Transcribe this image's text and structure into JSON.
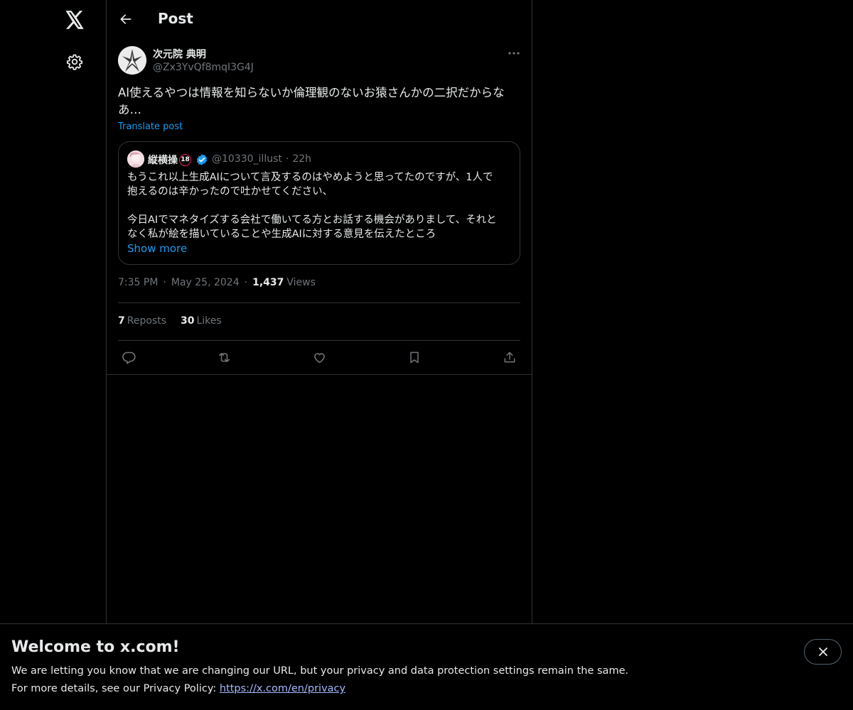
{
  "header": {
    "title": "Post"
  },
  "post": {
    "author_name": "次元院 典明",
    "author_handle": "@Zx3YvQf8mqI3G4J",
    "text": "AI使えるやつは情報を知らないか倫理観のないお猿さんかの二択だからなあ…",
    "translate_label": "Translate post",
    "time": "7:35 PM",
    "date": "May 25, 2024",
    "views_count": "1,437",
    "views_label": "Views",
    "reposts_count": "7",
    "reposts_label": "Reposts",
    "likes_count": "30",
    "likes_label": "Likes"
  },
  "quote": {
    "author_name": "縦横操",
    "badge": "18",
    "handle": "@10330_illust",
    "time_ago": "22h",
    "lines": [
      "もうこれ以上生成AIについて言及するのはやめようと思ってたのですが、1人で",
      "抱えるのは辛かったので吐かせてください、",
      "",
      "今日AIでマネタイズする会社で働いてる方とお話する機会がありまして、それと",
      "なく私が絵を描いていることや生成AIに対する意見を伝えたところ"
    ],
    "show_more": "Show more"
  },
  "banner": {
    "title": "Welcome to x.com!",
    "line1": "We are letting you know that we are changing our URL, but your privacy and data protection settings remain the same.",
    "line2_prefix": "For more details, see our Privacy Policy: ",
    "link": "https://x.com/en/privacy"
  },
  "icons": {
    "logo": "x-logo-icon",
    "settings": "gear-icon",
    "back": "arrow-left-icon",
    "more": "more-dots-icon",
    "reply": "reply-icon",
    "repost": "repost-icon",
    "like": "heart-icon",
    "bookmark": "bookmark-icon",
    "share": "share-icon",
    "close": "close-icon",
    "verified": "verified-badge-icon"
  },
  "colors": {
    "background": "#000000",
    "accent": "#1d9bf0",
    "muted": "#71767b",
    "text": "#e7e9ea",
    "border": "#2f3336"
  }
}
